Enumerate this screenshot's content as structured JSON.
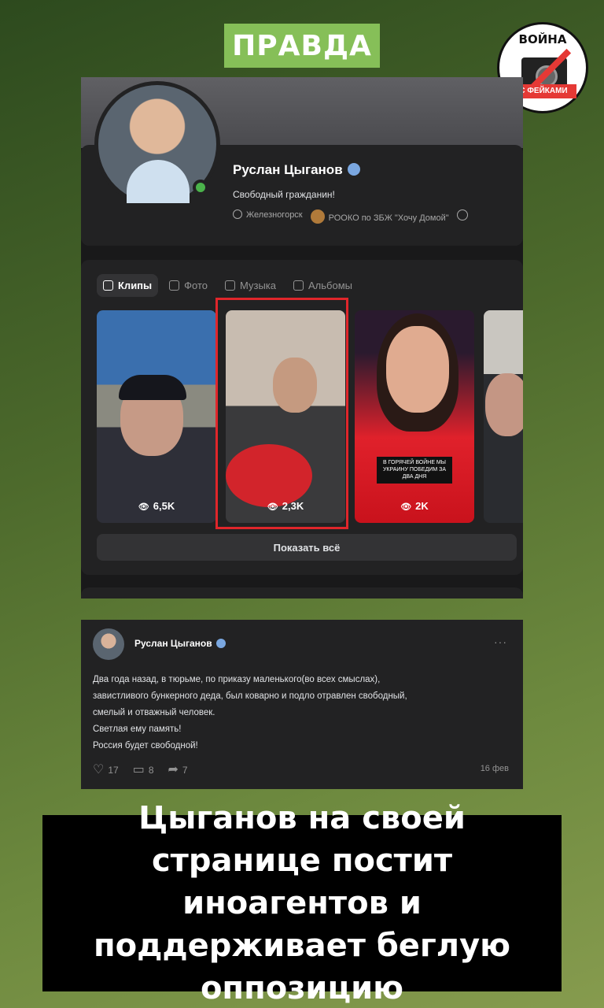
{
  "label": "ПРАВДА",
  "logo": {
    "top": "ВОЙНА",
    "bottom": "С ФЕЙКАМИ"
  },
  "profile": {
    "name": "Руслан Цыганов",
    "status": "Свободный гражданин!",
    "location": "Железногорск",
    "organization": "РООКО по ЗБЖ \"Хочу Домой\"",
    "info_icon": "info-icon"
  },
  "tabs": [
    {
      "label": "Клипы",
      "icon": "clips-icon"
    },
    {
      "label": "Фото",
      "icon": "photo-icon"
    },
    {
      "label": "Музыка",
      "icon": "music-icon"
    },
    {
      "label": "Альбомы",
      "icon": "albums-icon"
    }
  ],
  "clips": [
    {
      "views": "6,5K"
    },
    {
      "views": "2,3K"
    },
    {
      "views": "2K",
      "subtitle": "В ГОРЯЧЕЙ ВОЙНЕ МЫ УКРАИНУ ПОБЕДИМ ЗА ДВА ДНЯ"
    },
    {
      "views": ""
    }
  ],
  "show_all": "Показать всё",
  "post": {
    "author": "Руслан Цыганов",
    "more": "···",
    "lines": [
      "Два года назад, в тюрьме, по приказу маленького(во всех смыслах),",
      "завистливого бункерного деда, был коварно и подло отравлен свободный,",
      "смелый и отважный человек.",
      "Светлая ему память!",
      "Россия будет свободной!"
    ],
    "likes": "17",
    "comments": "8",
    "shares": "7",
    "date": "16 фев"
  },
  "caption": "Цыганов на своей странице постит иноагентов и поддерживает беглую оппозицию",
  "colors": {
    "label_bg": "#86bf58",
    "highlight": "#e0262b",
    "vk_dark": "#222223"
  }
}
